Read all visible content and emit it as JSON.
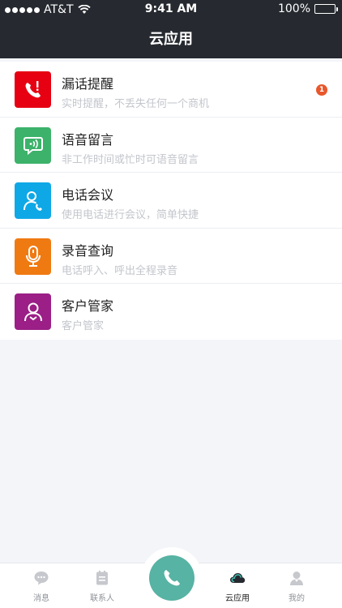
{
  "status_bar": {
    "carrier": "AT&T",
    "time": "9:41 AM",
    "battery": "100%"
  },
  "nav": {
    "title": "云应用"
  },
  "apps": [
    {
      "title": "漏话提醒",
      "subtitle": "实时提醒，不丢失任何一个商机",
      "icon": "missed-call-icon",
      "color": "#e60012",
      "badge": "1"
    },
    {
      "title": "语音留言",
      "subtitle": "非工作时间或忙时可语音留言",
      "icon": "voicemail-icon",
      "color": "#3cb26a"
    },
    {
      "title": "电话会议",
      "subtitle": "使用电话进行会议，简单快捷",
      "icon": "conference-call-icon",
      "color": "#0fa8e6"
    },
    {
      "title": "录音查询",
      "subtitle": "电话呼入、呼出全程录音",
      "icon": "microphone-icon",
      "color": "#f07a12"
    },
    {
      "title": "客户管家",
      "subtitle": "客户管家",
      "icon": "customer-icon",
      "color": "#9b1f86"
    }
  ],
  "tabs": [
    {
      "label": "消息",
      "icon": "message-icon"
    },
    {
      "label": "联系人",
      "icon": "contacts-icon"
    },
    {
      "label": "云应用",
      "icon": "cloud-icon",
      "active": true
    },
    {
      "label": "我的",
      "icon": "profile-icon"
    }
  ],
  "call_button": {
    "icon": "phone-icon",
    "color": "#57b3a3"
  }
}
